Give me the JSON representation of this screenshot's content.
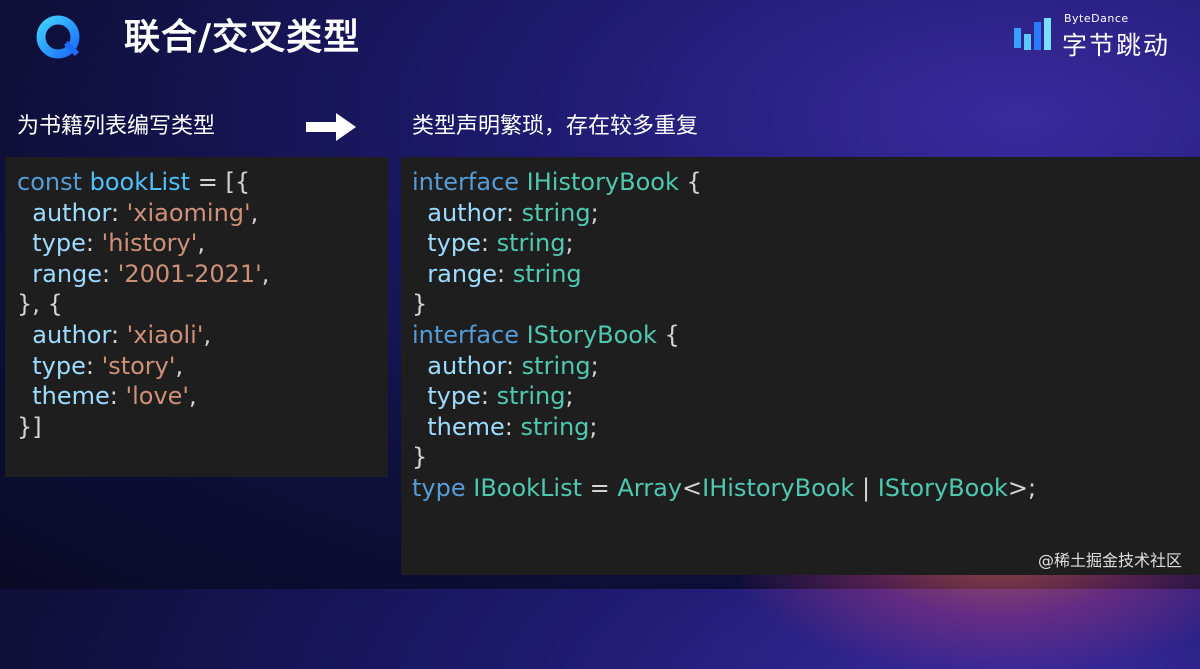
{
  "header": {
    "title": "联合/交叉类型",
    "logo_icon": "q-ring-logo-icon",
    "brand_small": "ByteDance",
    "brand_big": "字节跳动",
    "brand_icon": "bytedance-bars-icon"
  },
  "left": {
    "label": "为书籍列表编写类型",
    "arrow_icon": "right-arrow-icon",
    "code_lines": [
      [
        {
          "t": "const ",
          "c": "kw"
        },
        {
          "t": "bookList",
          "c": "var"
        },
        {
          "t": " = [{",
          "c": "punc"
        }
      ],
      [
        {
          "t": "  author",
          "c": "prop"
        },
        {
          "t": ": ",
          "c": "punc"
        },
        {
          "t": "'xiaoming'",
          "c": "str"
        },
        {
          "t": ",",
          "c": "punc"
        }
      ],
      [
        {
          "t": "  type",
          "c": "prop"
        },
        {
          "t": ": ",
          "c": "punc"
        },
        {
          "t": "'history'",
          "c": "str"
        },
        {
          "t": ",",
          "c": "punc"
        }
      ],
      [
        {
          "t": "  range",
          "c": "prop"
        },
        {
          "t": ": ",
          "c": "punc"
        },
        {
          "t": "'2001-2021'",
          "c": "str"
        },
        {
          "t": ",",
          "c": "punc"
        }
      ],
      [
        {
          "t": "}, {",
          "c": "punc"
        }
      ],
      [
        {
          "t": "  author",
          "c": "prop"
        },
        {
          "t": ": ",
          "c": "punc"
        },
        {
          "t": "'xiaoli'",
          "c": "str"
        },
        {
          "t": ",",
          "c": "punc"
        }
      ],
      [
        {
          "t": "  type",
          "c": "prop"
        },
        {
          "t": ": ",
          "c": "punc"
        },
        {
          "t": "'story'",
          "c": "str"
        },
        {
          "t": ",",
          "c": "punc"
        }
      ],
      [
        {
          "t": "  theme",
          "c": "prop"
        },
        {
          "t": ": ",
          "c": "punc"
        },
        {
          "t": "'love'",
          "c": "str"
        },
        {
          "t": ",",
          "c": "punc"
        }
      ],
      [
        {
          "t": "}]",
          "c": "punc"
        }
      ]
    ]
  },
  "right": {
    "label": "类型声明繁琐，存在较多重复",
    "code_lines": [
      [
        {
          "t": "interface ",
          "c": "kw"
        },
        {
          "t": "IHistoryBook",
          "c": "type"
        },
        {
          "t": " {",
          "c": "punc"
        }
      ],
      [
        {
          "t": "  author",
          "c": "prop"
        },
        {
          "t": ": ",
          "c": "punc"
        },
        {
          "t": "string",
          "c": "type"
        },
        {
          "t": ";",
          "c": "punc"
        }
      ],
      [
        {
          "t": "  type",
          "c": "prop"
        },
        {
          "t": ": ",
          "c": "punc"
        },
        {
          "t": "string",
          "c": "type"
        },
        {
          "t": ";",
          "c": "punc"
        }
      ],
      [
        {
          "t": "  range",
          "c": "prop"
        },
        {
          "t": ": ",
          "c": "punc"
        },
        {
          "t": "string",
          "c": "type"
        }
      ],
      [
        {
          "t": "}",
          "c": "punc"
        }
      ],
      [
        {
          "t": "interface ",
          "c": "kw"
        },
        {
          "t": "IStoryBook",
          "c": "type"
        },
        {
          "t": " {",
          "c": "punc"
        }
      ],
      [
        {
          "t": "  author",
          "c": "prop"
        },
        {
          "t": ": ",
          "c": "punc"
        },
        {
          "t": "string",
          "c": "type"
        },
        {
          "t": ";",
          "c": "punc"
        }
      ],
      [
        {
          "t": "  type",
          "c": "prop"
        },
        {
          "t": ": ",
          "c": "punc"
        },
        {
          "t": "string",
          "c": "type"
        },
        {
          "t": ";",
          "c": "punc"
        }
      ],
      [
        {
          "t": "  theme",
          "c": "prop"
        },
        {
          "t": ": ",
          "c": "punc"
        },
        {
          "t": "string",
          "c": "type"
        },
        {
          "t": ";",
          "c": "punc"
        }
      ],
      [
        {
          "t": "}",
          "c": "punc"
        }
      ],
      [
        {
          "t": "type ",
          "c": "kw"
        },
        {
          "t": "IBookList",
          "c": "type"
        },
        {
          "t": " = ",
          "c": "punc"
        },
        {
          "t": "Array",
          "c": "type"
        },
        {
          "t": "<",
          "c": "punc"
        },
        {
          "t": "IHistoryBook",
          "c": "type"
        },
        {
          "t": " | ",
          "c": "punc"
        },
        {
          "t": "IStoryBook",
          "c": "type"
        },
        {
          "t": ">;",
          "c": "punc"
        }
      ]
    ]
  },
  "footer": {
    "credit": "@稀土掘金技术社区"
  },
  "colors": {
    "keyword": "#569cd6",
    "variable": "#4fc1ff",
    "property": "#9cdcfe",
    "string": "#ce9178",
    "type": "#4ec9b0",
    "panel_bg": "#1e1e1e"
  }
}
